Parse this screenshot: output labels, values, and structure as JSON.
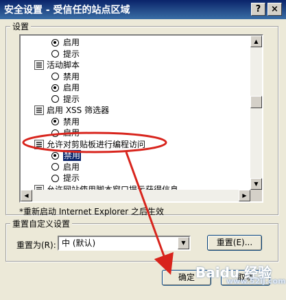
{
  "window": {
    "title": "安全设置 - 受信任的站点区域",
    "help_button": "?",
    "close_button": "×"
  },
  "settings": {
    "group_label": "设置",
    "rows": [
      {
        "kind": "radio",
        "label": "启用",
        "checked": true
      },
      {
        "kind": "radio",
        "label": "提示",
        "checked": false
      },
      {
        "kind": "header",
        "label": "活动脚本"
      },
      {
        "kind": "radio",
        "label": "禁用",
        "checked": false
      },
      {
        "kind": "radio",
        "label": "启用",
        "checked": true
      },
      {
        "kind": "radio",
        "label": "提示",
        "checked": false
      },
      {
        "kind": "header",
        "label": "启用 XSS 筛选器"
      },
      {
        "kind": "radio",
        "label": "禁用",
        "checked": true
      },
      {
        "kind": "radio",
        "label": "启用",
        "checked": false
      },
      {
        "kind": "header",
        "label": "允许对剪贴板进行编程访问"
      },
      {
        "kind": "radio",
        "label": "禁用",
        "checked": true,
        "selected": true
      },
      {
        "kind": "radio",
        "label": "启用",
        "checked": false
      },
      {
        "kind": "radio",
        "label": "提示",
        "checked": false
      },
      {
        "kind": "header",
        "label": "允许网站使用脚本窗口提示获得信息"
      }
    ],
    "note": "*重新启动 Internet Explorer 之后生效"
  },
  "reset": {
    "group_label": "重置自定义设置",
    "label": "重置为(R):",
    "selected_value": "中 (默认)",
    "reset_button": "重置(E)..."
  },
  "footer": {
    "ok_button": "确定",
    "cancel_button": "取消"
  },
  "watermark": {
    "brand": "Baidu 经验",
    "sub": "www.52ij.com"
  },
  "colors": {
    "annotation_red": "#d8241c",
    "title_bar": "#0a246a",
    "selection": "#0a246a"
  }
}
